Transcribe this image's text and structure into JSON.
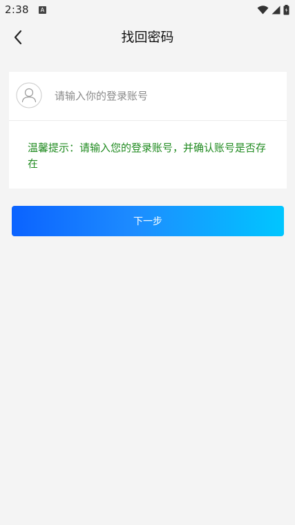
{
  "status_bar": {
    "time": "2:38",
    "app_icon_letter": "A",
    "icons": [
      "wifi-icon",
      "signal-icon",
      "battery-icon"
    ]
  },
  "nav": {
    "back_icon": "chevron-left-icon",
    "title": "找回密码"
  },
  "form": {
    "account_icon": "user-avatar-icon",
    "account_placeholder": "请输入你的登录账号",
    "account_value": "",
    "hint": "温馨提示：请输入您的登录账号，并确认账号是否存在"
  },
  "actions": {
    "next_label": "下一步"
  },
  "colors": {
    "background": "#f4f4f4",
    "hint_green": "#1f8a1f",
    "button_gradient_start": "#0b63ff",
    "button_gradient_end": "#00c6ff"
  }
}
